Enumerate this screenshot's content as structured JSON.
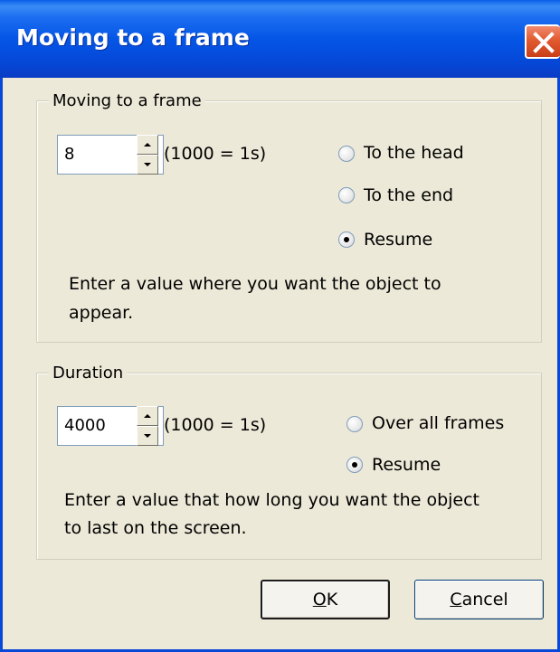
{
  "window": {
    "title": "Moving to a frame",
    "colors": {
      "titlebar": "#0556e6",
      "close_button": "#e25a30",
      "face": "#ece9d8"
    }
  },
  "frame_group": {
    "legend": "Moving to a frame",
    "value": "8",
    "unit_hint": "(1000 = 1s)",
    "options": [
      {
        "label": "To the head",
        "selected": false
      },
      {
        "label": "To the end",
        "selected": false
      },
      {
        "label": "Resume",
        "selected": true
      }
    ],
    "help_line1": "Enter a value where you want the object to",
    "help_line2": "appear."
  },
  "duration_group": {
    "legend": "Duration",
    "value": "4000",
    "unit_hint": "(1000 = 1s)",
    "options": [
      {
        "label": "Over all frames",
        "selected": false
      },
      {
        "label": "Resume",
        "selected": true
      }
    ],
    "help_line1": "Enter a value that how long you want the object",
    "help_line2": "to last on the screen."
  },
  "buttons": {
    "ok_mnemonic": "O",
    "ok_rest": "K",
    "cancel_mnemonic": "C",
    "cancel_rest": "ancel"
  }
}
